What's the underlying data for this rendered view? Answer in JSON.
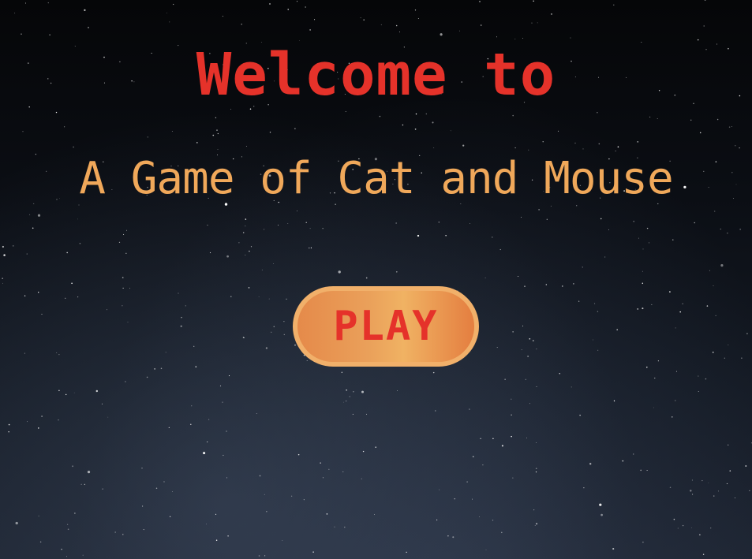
{
  "screen": {
    "welcome_text": "Welcome to",
    "subtitle_text": "A Game of Cat and Mouse",
    "play_label": "PLAY"
  },
  "colors": {
    "welcome": "#e5322a",
    "subtitle": "#f0a85a",
    "play_text": "#e5322a",
    "button_fill": "#eaa05a",
    "background": "#0b0e14"
  }
}
